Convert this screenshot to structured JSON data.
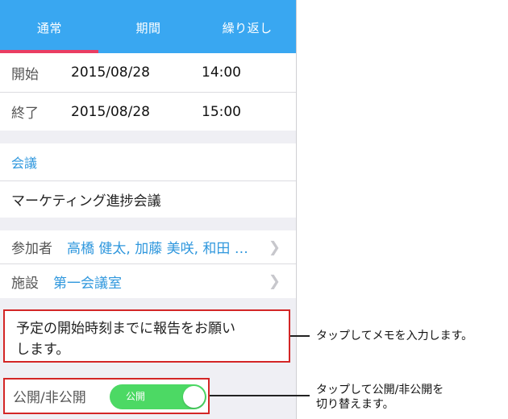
{
  "tabs": [
    {
      "label": "通常"
    },
    {
      "label": "期間"
    },
    {
      "label": "繰り返し"
    }
  ],
  "datetime": {
    "start": {
      "label": "開始",
      "date": "2015/08/28",
      "time": "14:00"
    },
    "end": {
      "label": "終了",
      "date": "2015/08/28",
      "time": "15:00"
    }
  },
  "event": {
    "category": "会議",
    "title": "マーケティング進捗会議"
  },
  "people": {
    "participants_label": "参加者",
    "participants_value": "高橋 健太, 加藤 美咲, 和田 …",
    "facility_label": "施設",
    "facility_value": "第一会議室"
  },
  "memo": {
    "line1": "予定の開始時刻までに報告をお願い",
    "line2": "します。"
  },
  "visibility": {
    "label": "公開/非公開",
    "toggle_text": "公開"
  },
  "annotations": {
    "memo": "タップしてメモを入力します。",
    "visibility_line1": "タップして公開/非公開を",
    "visibility_line2": "切り替えます。"
  },
  "colors": {
    "tab_bar": "#39a7f1",
    "tab_indicator": "#ea3d62",
    "link_blue": "#2f97dd",
    "toggle_on": "#4cd964",
    "callout_border": "#d32626"
  },
  "icons": {
    "chevron": "chevron-right-icon"
  }
}
